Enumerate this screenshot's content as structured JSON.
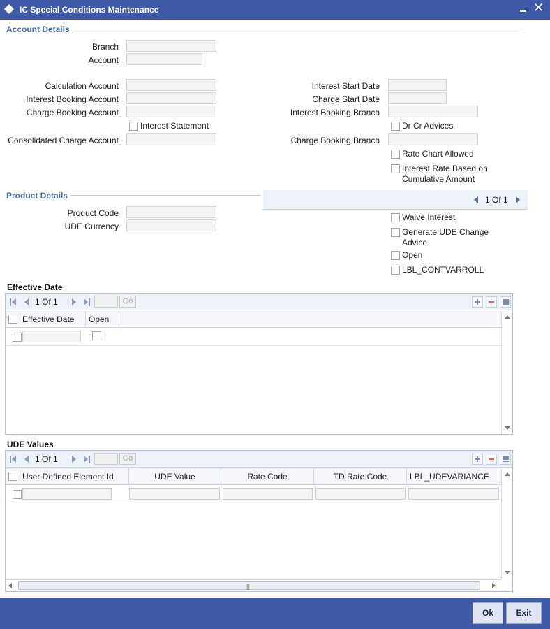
{
  "window": {
    "title": "IC Special Conditions Maintenance",
    "close_glyph": "✕"
  },
  "account_details": {
    "section_title": "Account Details",
    "branch_label": "Branch",
    "branch_value": "",
    "account_label": "Account",
    "account_value": "",
    "calculation_account_label": "Calculation Account",
    "calculation_account_value": "",
    "interest_booking_account_label": "Interest Booking Account",
    "interest_booking_account_value": "",
    "charge_booking_account_label": "Charge Booking Account",
    "charge_booking_account_value": "",
    "interest_statement_label": "Interest Statement",
    "consolidated_charge_account_label": "Consolidated Charge Account",
    "consolidated_charge_account_value": "",
    "interest_start_date_label": "Interest Start Date",
    "interest_start_date_value": "",
    "charge_start_date_label": "Charge Start Date",
    "charge_start_date_value": "",
    "interest_booking_branch_label": "Interest Booking Branch",
    "interest_booking_branch_value": "",
    "dr_cr_advices_label": "Dr Cr Advices",
    "charge_booking_branch_label": "Charge Booking Branch",
    "charge_booking_branch_value": "",
    "rate_chart_allowed_label": "Rate Chart Allowed",
    "interest_rate_cumulative_line1": "Interest Rate Based on",
    "interest_rate_cumulative_line2": "Cumulative Amount"
  },
  "product_details": {
    "section_title": "Product Details",
    "product_code_label": "Product Code",
    "product_code_value": "",
    "ude_currency_label": "UDE Currency",
    "ude_currency_value": "",
    "pager_text": "1 Of 1",
    "waive_interest_label": "Waive Interest",
    "generate_ude_line1": "Generate UDE Change",
    "generate_ude_line2": "Advice",
    "open_label": "Open",
    "contvarroll_label": "LBL_CONTVARROLL"
  },
  "effective_date_grid": {
    "title": "Effective Date",
    "pager_text": "1 Of 1",
    "go_label": "Go",
    "columns": [
      "Effective Date",
      "Open"
    ]
  },
  "ude_values_grid": {
    "title": "UDE Values",
    "pager_text": "1 Of 1",
    "go_label": "Go",
    "columns": [
      "User Defined Element Id",
      "UDE Value",
      "Rate Code",
      "TD Rate Code",
      "LBL_UDEVARIANCE"
    ],
    "scroll_grip": "|||"
  },
  "footer": {
    "ok_label": "Ok",
    "exit_label": "Exit"
  }
}
